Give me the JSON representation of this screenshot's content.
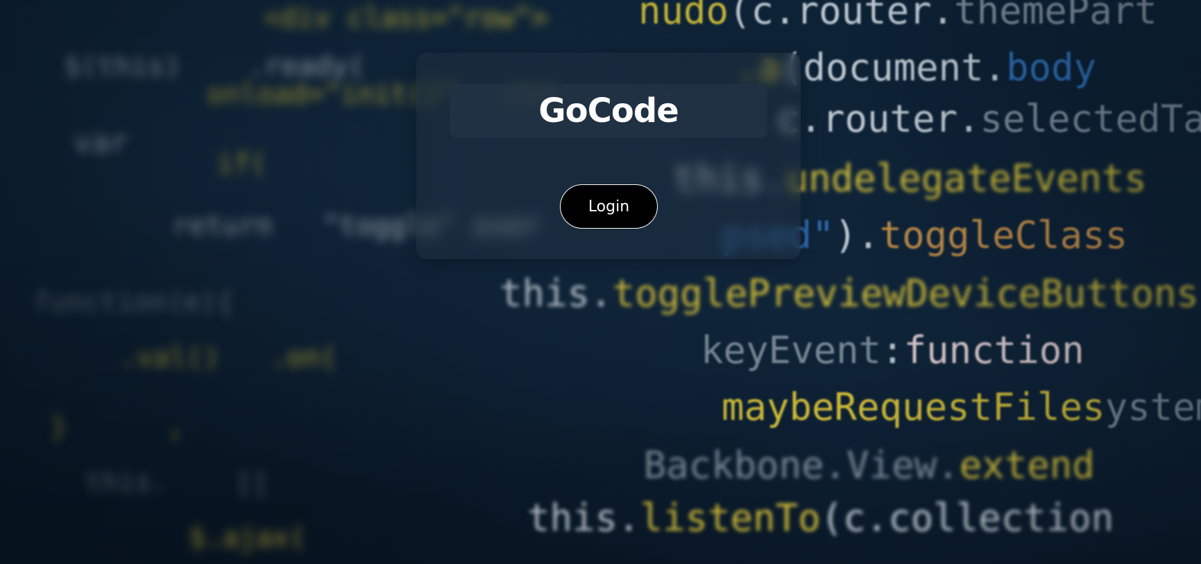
{
  "app": {
    "title": "GoCode",
    "login_label": "Login"
  },
  "background": {
    "lines": [
      "(c.router.themePart",
      ".a(document.body",
      "c.router.selectedTa",
      "this.undelegateEvents",
      "psed\").toggleClass",
      "this.togglePreviewDeviceButtons",
      "keyEvent:function",
      "maybeRequestFilesystem",
      "Backbone.View.extend",
      "this.listenTo(c.collection"
    ]
  },
  "colors": {
    "card_bg": "#28374659",
    "title_box_bg": "#233444bf",
    "title_text": "#ffffff",
    "button_bg": "#000000",
    "button_text": "#ffffff",
    "code_yellow": "#d9c43a",
    "code_white": "#c9d3dc",
    "code_blue": "#2f6fb8"
  }
}
